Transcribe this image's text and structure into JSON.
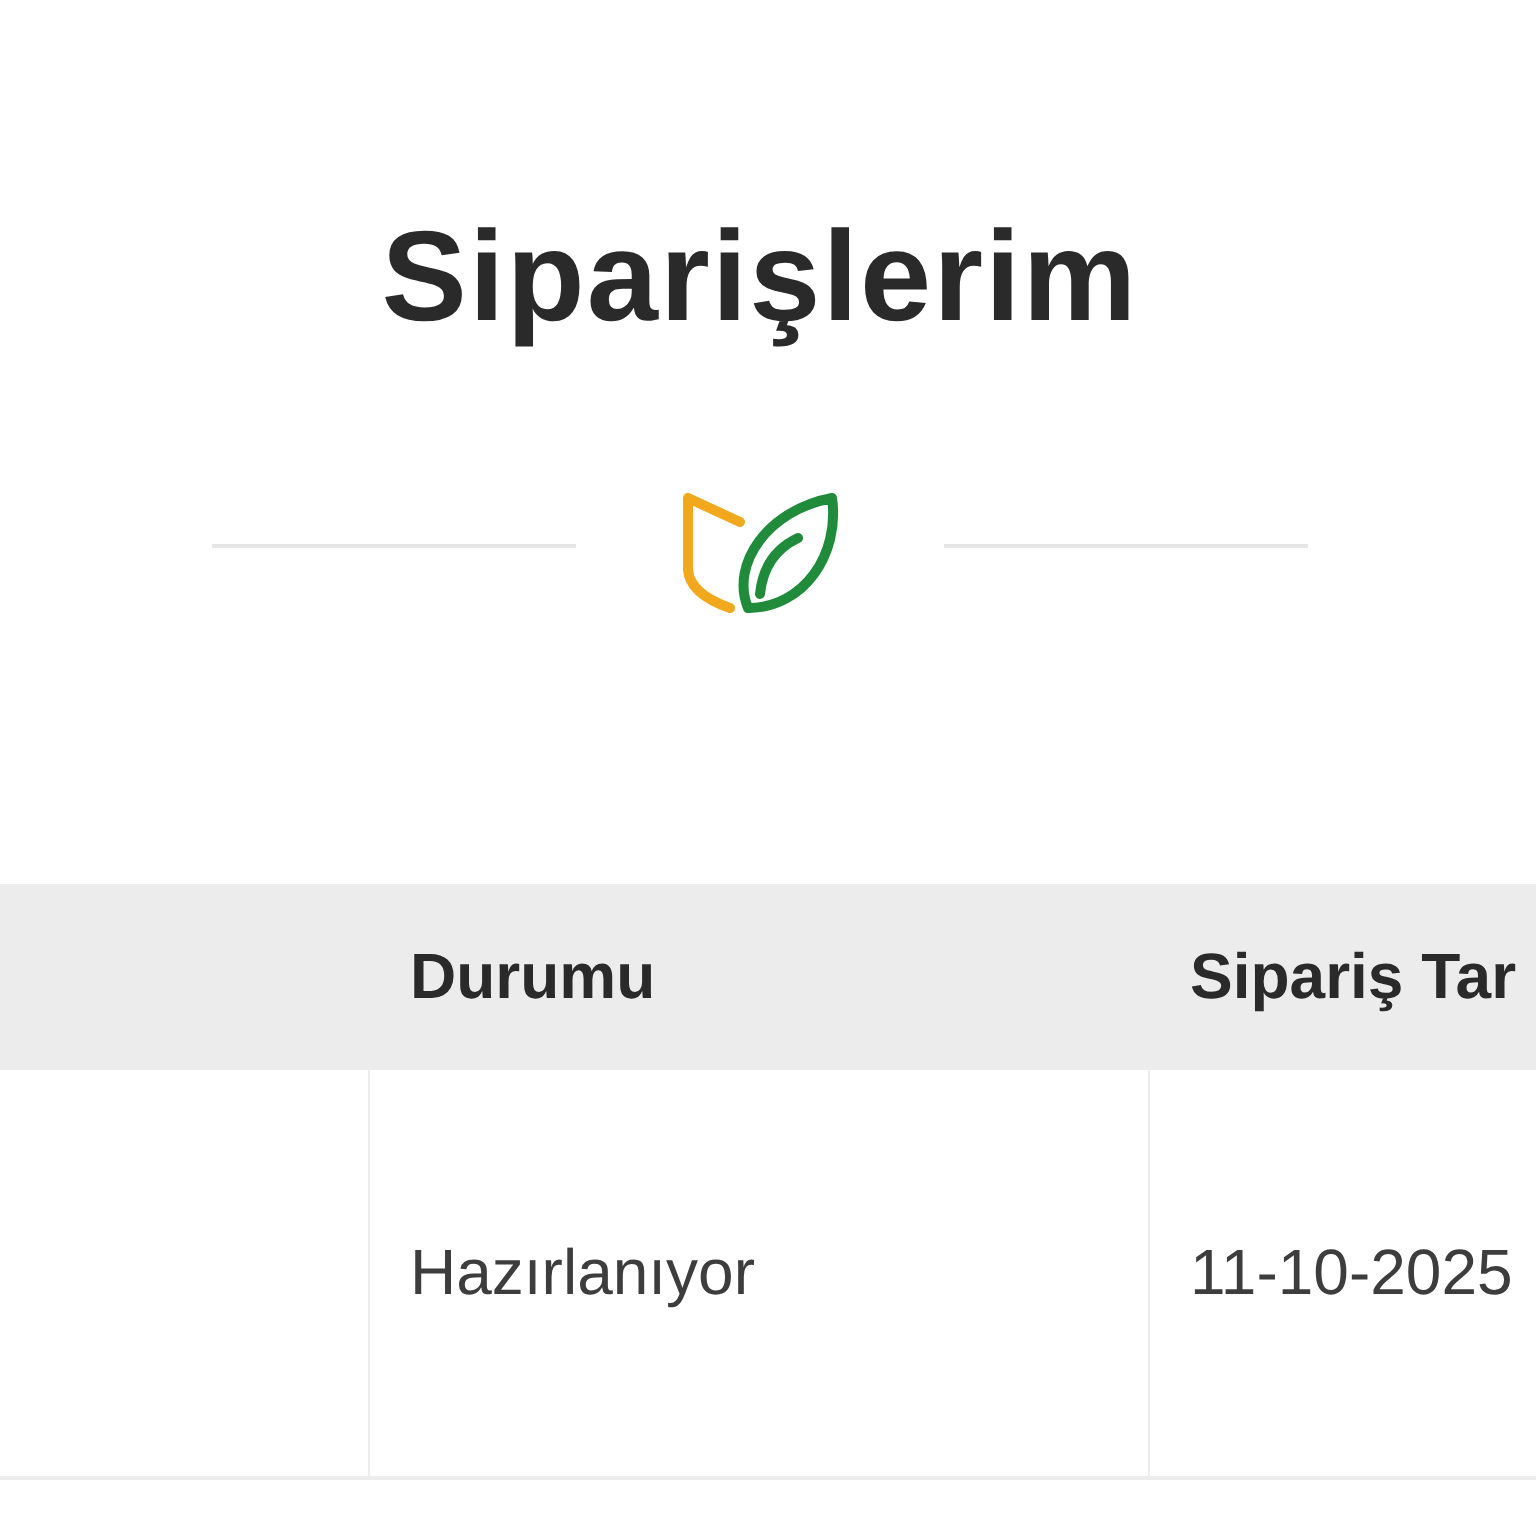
{
  "page": {
    "title": "Siparişlerim"
  },
  "table": {
    "columns": [
      "Durumu",
      "Sipariş Tar"
    ],
    "rows": [
      [
        "Hazırlanıyor",
        "11-10-2025"
      ]
    ]
  }
}
